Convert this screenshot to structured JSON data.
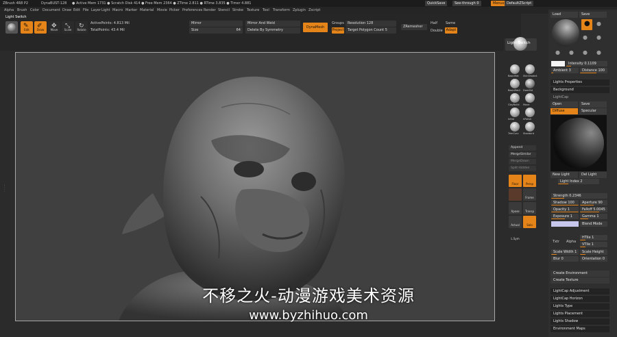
{
  "titlebar": {
    "app": "ZBrush 4R8 P2",
    "project": "DynaBUST-128",
    "stats": "● Active Mem 1731 ● Scratch Disk 414 ● Free Mem 2364 ● ZTime 2.811 ● RTime 3.835 ● Timer 4.881",
    "quicksave": "QuickSave",
    "seethrough": "See-through 0",
    "menus": "Menus",
    "script": "DefaultZScript"
  },
  "menubar": [
    "Alpha",
    "Brush",
    "Color",
    "Document",
    "Draw",
    "Edit",
    "File",
    "Layer",
    "Light",
    "Macro",
    "Marker",
    "Material",
    "Movie",
    "Picker",
    "Preferences",
    "Render",
    "Stencil",
    "Stroke",
    "Texture",
    "Tool",
    "Transform",
    "Zplugin",
    "Zscript"
  ],
  "shelf": {
    "title": "Light Switch",
    "tools": [
      {
        "label": "Edit",
        "on": true
      },
      {
        "label": "Draw",
        "on": true
      },
      {
        "label": "Move",
        "on": false
      },
      {
        "label": "Scale",
        "on": false
      },
      {
        "label": "Rotate",
        "on": false
      }
    ],
    "active_points": "ActivePoints: 4.813 Mil",
    "total_points": "TotalPoints: 43.4 Mil",
    "mirror": "Mirror",
    "size": "Size",
    "size_val": "64",
    "mirror_weld": "Mirror And Weld",
    "delete_sym": "Delete By Symmetry",
    "dynamesh": "DynaMesh",
    "groups": "Groups",
    "resolution": "Resolution 128",
    "project": "Project",
    "target_poly": "Target Polygon Count 5",
    "zremesher": "ZRemesher",
    "half": "Half",
    "same": "Same",
    "double": "Double",
    "adapt": "Adapt"
  },
  "rightshelf": {
    "light_switch": "Light Switch",
    "materials": [
      "BasicMat",
      "SkinShade4",
      "BasicMat2",
      "DamStd",
      "ClayBuild",
      "Move",
      "Inflat",
      "hPolish",
      "TrimCurv",
      "Standard",
      "ClipCurve",
      "Blob"
    ],
    "append": "Append",
    "merge": "MergeSimilar",
    "merge_down": "MergeDown",
    "split": "Split Hidden",
    "btns": [
      {
        "label": "Floor",
        "on": true
      },
      {
        "label": "Persp",
        "on": true
      },
      {
        "label": "",
        "on": false
      },
      {
        "label": "Frame",
        "on": false
      },
      {
        "label": "Xpose",
        "on": false
      },
      {
        "label": "Transp",
        "on": false
      },
      {
        "label": "Actual",
        "on": false
      },
      {
        "label": "Solo",
        "on": true
      },
      {
        "label": "L.Sym",
        "on": false
      }
    ]
  },
  "panel": {
    "load": "Load",
    "save": "Save",
    "intensity": "Intensity 0.1109",
    "ambient": "Ambient 3",
    "distance": "Distance 100",
    "light_properties": "Lights Properties",
    "background": "Background",
    "lightcap": "LightCap",
    "open": "Open",
    "save2": "Save",
    "diffuse": "Diffuse",
    "specular": "Specular",
    "new_light": "New Light",
    "del_light": "Del Light",
    "light_index": "Light Index 2",
    "strength": "Strength 0.2346",
    "shadow": "Shadow 100",
    "aperture": "Aperture 90",
    "opacity": "Opacity 1",
    "falloff": "Falloff 5.0045",
    "exposure": "Exposure 1",
    "gamma": "Gamma 1",
    "blend_mode": "Blend Mode",
    "txtr": "Txtr",
    "alpha": "Alpha",
    "hide": "HTile 1",
    "vtile": "VTile 1",
    "scale_width": "Scale Width 1",
    "scale_height": "Scale Height",
    "blur": "Blur 0",
    "orientation": "Orientation 0",
    "create_env": "Create Environment",
    "create_tex": "Create Texture",
    "lightcap_adj": "LightCap Adjustment",
    "lightcap_horizon": "LightCap Horizon",
    "lights_type": "Lights Type",
    "lights_placement": "Lights Placement",
    "lights_shadow": "Lights Shadow",
    "env_maps": "Environment Maps"
  },
  "watermark": {
    "line1": "不移之火-动漫游戏美术资源",
    "line2": "www.byzhihuo.com"
  },
  "accent": "#e58418"
}
